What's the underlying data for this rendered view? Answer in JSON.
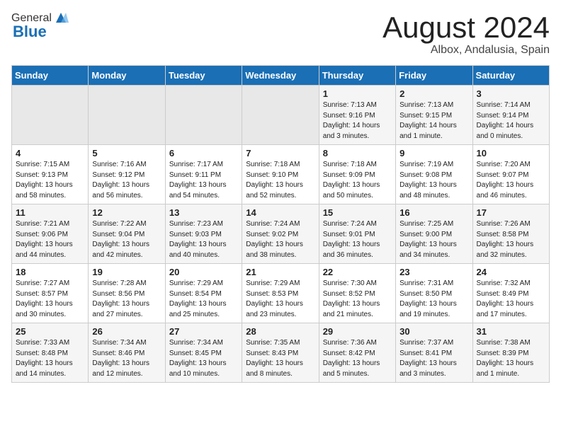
{
  "header": {
    "logo_general": "General",
    "logo_blue": "Blue",
    "month_title": "August 2024",
    "location": "Albox, Andalusia, Spain"
  },
  "days_of_week": [
    "Sunday",
    "Monday",
    "Tuesday",
    "Wednesday",
    "Thursday",
    "Friday",
    "Saturday"
  ],
  "weeks": [
    [
      {
        "day": "",
        "info": ""
      },
      {
        "day": "",
        "info": ""
      },
      {
        "day": "",
        "info": ""
      },
      {
        "day": "",
        "info": ""
      },
      {
        "day": "1",
        "info": "Sunrise: 7:13 AM\nSunset: 9:16 PM\nDaylight: 14 hours\nand 3 minutes."
      },
      {
        "day": "2",
        "info": "Sunrise: 7:13 AM\nSunset: 9:15 PM\nDaylight: 14 hours\nand 1 minute."
      },
      {
        "day": "3",
        "info": "Sunrise: 7:14 AM\nSunset: 9:14 PM\nDaylight: 14 hours\nand 0 minutes."
      }
    ],
    [
      {
        "day": "4",
        "info": "Sunrise: 7:15 AM\nSunset: 9:13 PM\nDaylight: 13 hours\nand 58 minutes."
      },
      {
        "day": "5",
        "info": "Sunrise: 7:16 AM\nSunset: 9:12 PM\nDaylight: 13 hours\nand 56 minutes."
      },
      {
        "day": "6",
        "info": "Sunrise: 7:17 AM\nSunset: 9:11 PM\nDaylight: 13 hours\nand 54 minutes."
      },
      {
        "day": "7",
        "info": "Sunrise: 7:18 AM\nSunset: 9:10 PM\nDaylight: 13 hours\nand 52 minutes."
      },
      {
        "day": "8",
        "info": "Sunrise: 7:18 AM\nSunset: 9:09 PM\nDaylight: 13 hours\nand 50 minutes."
      },
      {
        "day": "9",
        "info": "Sunrise: 7:19 AM\nSunset: 9:08 PM\nDaylight: 13 hours\nand 48 minutes."
      },
      {
        "day": "10",
        "info": "Sunrise: 7:20 AM\nSunset: 9:07 PM\nDaylight: 13 hours\nand 46 minutes."
      }
    ],
    [
      {
        "day": "11",
        "info": "Sunrise: 7:21 AM\nSunset: 9:06 PM\nDaylight: 13 hours\nand 44 minutes."
      },
      {
        "day": "12",
        "info": "Sunrise: 7:22 AM\nSunset: 9:04 PM\nDaylight: 13 hours\nand 42 minutes."
      },
      {
        "day": "13",
        "info": "Sunrise: 7:23 AM\nSunset: 9:03 PM\nDaylight: 13 hours\nand 40 minutes."
      },
      {
        "day": "14",
        "info": "Sunrise: 7:24 AM\nSunset: 9:02 PM\nDaylight: 13 hours\nand 38 minutes."
      },
      {
        "day": "15",
        "info": "Sunrise: 7:24 AM\nSunset: 9:01 PM\nDaylight: 13 hours\nand 36 minutes."
      },
      {
        "day": "16",
        "info": "Sunrise: 7:25 AM\nSunset: 9:00 PM\nDaylight: 13 hours\nand 34 minutes."
      },
      {
        "day": "17",
        "info": "Sunrise: 7:26 AM\nSunset: 8:58 PM\nDaylight: 13 hours\nand 32 minutes."
      }
    ],
    [
      {
        "day": "18",
        "info": "Sunrise: 7:27 AM\nSunset: 8:57 PM\nDaylight: 13 hours\nand 30 minutes."
      },
      {
        "day": "19",
        "info": "Sunrise: 7:28 AM\nSunset: 8:56 PM\nDaylight: 13 hours\nand 27 minutes."
      },
      {
        "day": "20",
        "info": "Sunrise: 7:29 AM\nSunset: 8:54 PM\nDaylight: 13 hours\nand 25 minutes."
      },
      {
        "day": "21",
        "info": "Sunrise: 7:29 AM\nSunset: 8:53 PM\nDaylight: 13 hours\nand 23 minutes."
      },
      {
        "day": "22",
        "info": "Sunrise: 7:30 AM\nSunset: 8:52 PM\nDaylight: 13 hours\nand 21 minutes."
      },
      {
        "day": "23",
        "info": "Sunrise: 7:31 AM\nSunset: 8:50 PM\nDaylight: 13 hours\nand 19 minutes."
      },
      {
        "day": "24",
        "info": "Sunrise: 7:32 AM\nSunset: 8:49 PM\nDaylight: 13 hours\nand 17 minutes."
      }
    ],
    [
      {
        "day": "25",
        "info": "Sunrise: 7:33 AM\nSunset: 8:48 PM\nDaylight: 13 hours\nand 14 minutes."
      },
      {
        "day": "26",
        "info": "Sunrise: 7:34 AM\nSunset: 8:46 PM\nDaylight: 13 hours\nand 12 minutes."
      },
      {
        "day": "27",
        "info": "Sunrise: 7:34 AM\nSunset: 8:45 PM\nDaylight: 13 hours\nand 10 minutes."
      },
      {
        "day": "28",
        "info": "Sunrise: 7:35 AM\nSunset: 8:43 PM\nDaylight: 13 hours\nand 8 minutes."
      },
      {
        "day": "29",
        "info": "Sunrise: 7:36 AM\nSunset: 8:42 PM\nDaylight: 13 hours\nand 5 minutes."
      },
      {
        "day": "30",
        "info": "Sunrise: 7:37 AM\nSunset: 8:41 PM\nDaylight: 13 hours\nand 3 minutes."
      },
      {
        "day": "31",
        "info": "Sunrise: 7:38 AM\nSunset: 8:39 PM\nDaylight: 13 hours\nand 1 minute."
      }
    ]
  ]
}
